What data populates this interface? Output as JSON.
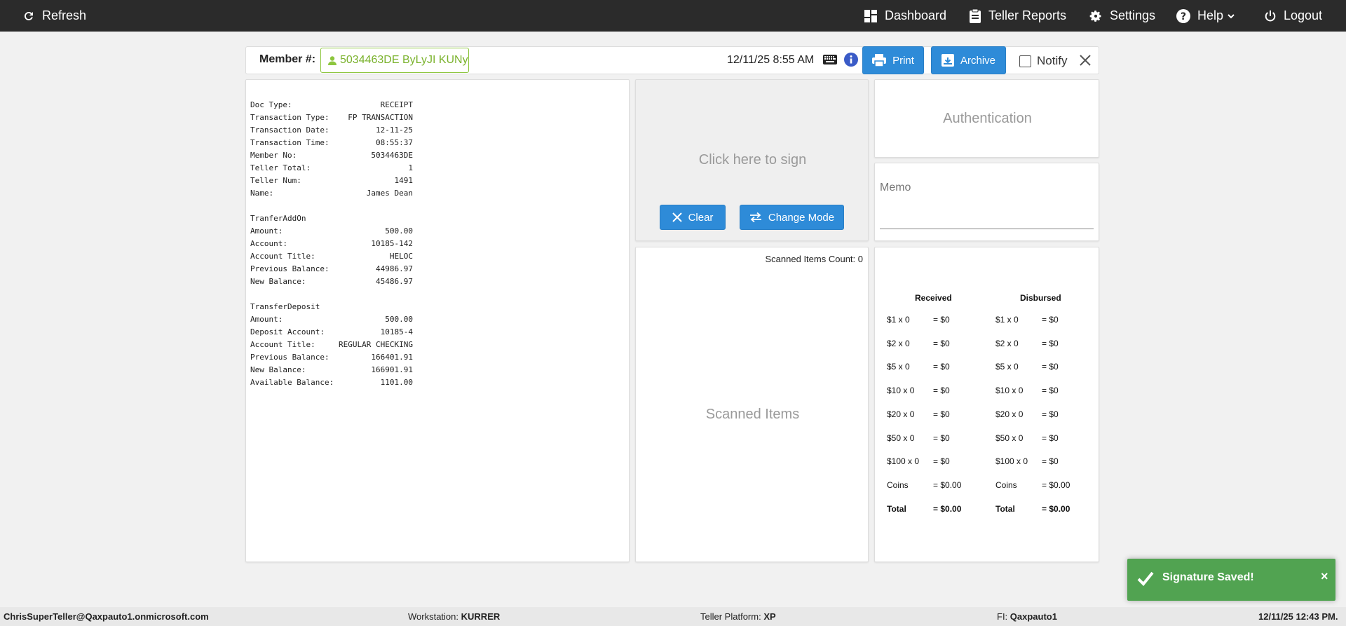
{
  "nav": {
    "refresh": "Refresh",
    "dashboard": "Dashboard",
    "teller_reports": "Teller Reports",
    "settings": "Settings",
    "help": "Help",
    "logout": "Logout"
  },
  "header": {
    "member_label": "Member #:",
    "member_value": "5034463DE ByLyJI KUNy",
    "datetime": "12/11/25 8:55 AM",
    "print": "Print",
    "archive": "Archive",
    "notify": "Notify"
  },
  "receipt": {
    "sections": [
      [
        {
          "k": "Doc Type:",
          "v": "RECEIPT"
        },
        {
          "k": "Transaction Type:",
          "v": "FP TRANSACTION"
        },
        {
          "k": "Transaction Date:",
          "v": "12-11-25"
        },
        {
          "k": "Transaction Time:",
          "v": "08:55:37"
        },
        {
          "k": "Member No:",
          "v": "5034463DE"
        },
        {
          "k": "Teller Total:",
          "v": "1"
        },
        {
          "k": "Teller Num:",
          "v": "1491"
        },
        {
          "k": "Name:",
          "v": "James Dean"
        }
      ],
      [
        {
          "k": "TranferAddOn",
          "v": ""
        },
        {
          "k": "Amount:",
          "v": "500.00"
        },
        {
          "k": "Account:",
          "v": "10185-142"
        },
        {
          "k": "Account Title:",
          "v": "HELOC"
        },
        {
          "k": "Previous Balance:",
          "v": "44986.97"
        },
        {
          "k": "New Balance:",
          "v": "45486.97"
        }
      ],
      [
        {
          "k": "TransferDeposit",
          "v": ""
        },
        {
          "k": "Amount:",
          "v": "500.00"
        },
        {
          "k": "Deposit Account:",
          "v": "10185-4"
        },
        {
          "k": "Account Title:",
          "v": "REGULAR CHECKING"
        },
        {
          "k": "Previous Balance:",
          "v": "166401.91"
        },
        {
          "k": "New Balance:",
          "v": "166901.91"
        },
        {
          "k": "Available Balance:",
          "v": "1101.00"
        }
      ]
    ]
  },
  "signature": {
    "prompt": "Click here to sign",
    "clear": "Clear",
    "change_mode": "Change Mode"
  },
  "scanned": {
    "count_label": "Scanned Items Count: 0",
    "placeholder": "Scanned Items"
  },
  "auth": {
    "label": "Authentication"
  },
  "memo": {
    "label": "Memo"
  },
  "cash": {
    "received_header": "Received",
    "disbursed_header": "Disbursed",
    "rows": [
      {
        "r_label": "$1 x 0",
        "r_val": "= $0",
        "d_label": "$1 x 0",
        "d_val": "= $0"
      },
      {
        "r_label": "$2 x 0",
        "r_val": "= $0",
        "d_label": "$2 x 0",
        "d_val": "= $0"
      },
      {
        "r_label": "$5 x 0",
        "r_val": "= $0",
        "d_label": "$5 x 0",
        "d_val": "= $0"
      },
      {
        "r_label": "$10 x 0",
        "r_val": "= $0",
        "d_label": "$10 x 0",
        "d_val": "= $0"
      },
      {
        "r_label": "$20 x 0",
        "r_val": "= $0",
        "d_label": "$20 x 0",
        "d_val": "= $0"
      },
      {
        "r_label": "$50 x 0",
        "r_val": "= $0",
        "d_label": "$50 x 0",
        "d_val": "= $0"
      },
      {
        "r_label": "$100 x 0",
        "r_val": "= $0",
        "d_label": "$100 x 0",
        "d_val": "= $0"
      },
      {
        "r_label": "Coins",
        "r_val": "= $0.00",
        "d_label": "Coins",
        "d_val": "= $0.00"
      },
      {
        "r_label": "Total",
        "r_val": "= $0.00",
        "d_label": "Total",
        "d_val": "= $0.00"
      }
    ]
  },
  "toast": {
    "message": "Signature Saved!",
    "close": "×"
  },
  "footer": {
    "user": "ChrisSuperTeller@Qaxpauto1.onmicrosoft.com",
    "workstation_label": "Workstation:",
    "workstation": "KURRER",
    "platform_label": "Teller Platform:",
    "platform": "XP",
    "fi_label": "FI:",
    "fi": "Qaxpauto1",
    "datetime": "12/11/25 12:43 PM."
  }
}
